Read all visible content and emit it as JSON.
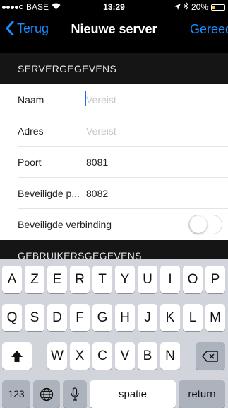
{
  "status": {
    "carrier": "BASE",
    "time": "13:29",
    "battery_text": "20%",
    "battery_level": 0.2
  },
  "nav": {
    "back_label": "Terug",
    "title": "Nieuwe server",
    "done_label": "Gereed"
  },
  "sections": {
    "server": "SERVERGEGEVENS",
    "user": "GEBRUIKERSGEGEVENS"
  },
  "form": {
    "name": {
      "label": "Naam",
      "placeholder": "Vereist"
    },
    "address": {
      "label": "Adres",
      "placeholder": "Vereist"
    },
    "port": {
      "label": "Poort",
      "value": "8081"
    },
    "secure_port": {
      "label": "Beveiligde p...",
      "value": "8082"
    },
    "secure_connection": {
      "label": "Beveiligde verbinding",
      "enabled": false
    }
  },
  "keyboard": {
    "row1": [
      "A",
      "Z",
      "E",
      "R",
      "T",
      "Y",
      "U",
      "I",
      "O",
      "P"
    ],
    "row2": [
      "Q",
      "S",
      "D",
      "F",
      "G",
      "H",
      "J",
      "K",
      "L",
      "M"
    ],
    "row3": [
      "W",
      "X",
      "C",
      "V",
      "B",
      "N"
    ],
    "numbers_label": "123",
    "space_label": "spatie",
    "return_label": "return"
  },
  "colors": {
    "accent": "#1a8cff",
    "header_bg": "#151515",
    "keyboard_bg": "#d1d5db"
  }
}
